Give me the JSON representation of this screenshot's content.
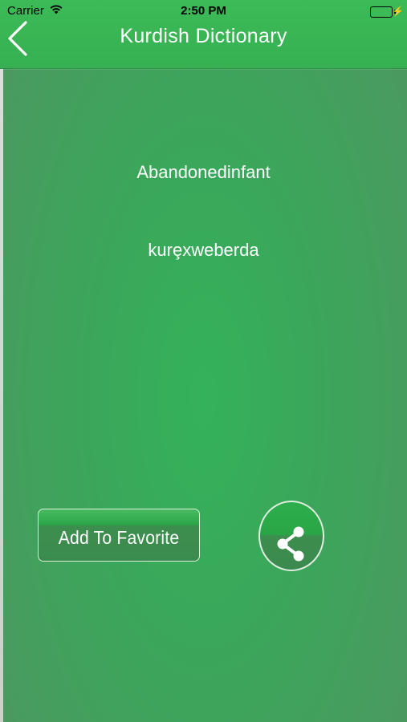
{
  "status_bar": {
    "carrier": "Carrier",
    "time": "2:50 PM",
    "icons": [
      "wifi-icon",
      "battery-icon",
      "charging-bolt-icon"
    ]
  },
  "header": {
    "title": "Kurdish Dictionary",
    "back_icon": "chevron-left-icon"
  },
  "entry": {
    "word": "Abandonedinfant",
    "translation": "kurȩxweberda"
  },
  "actions": {
    "favorite_label": "Add To Favorite",
    "share_icon": "share-icon"
  },
  "colors": {
    "header": "#3dbb57",
    "background_center": "#34b25a",
    "background_edge": "#4a9a60",
    "button": "#2aa646",
    "text": "#ffffff"
  }
}
